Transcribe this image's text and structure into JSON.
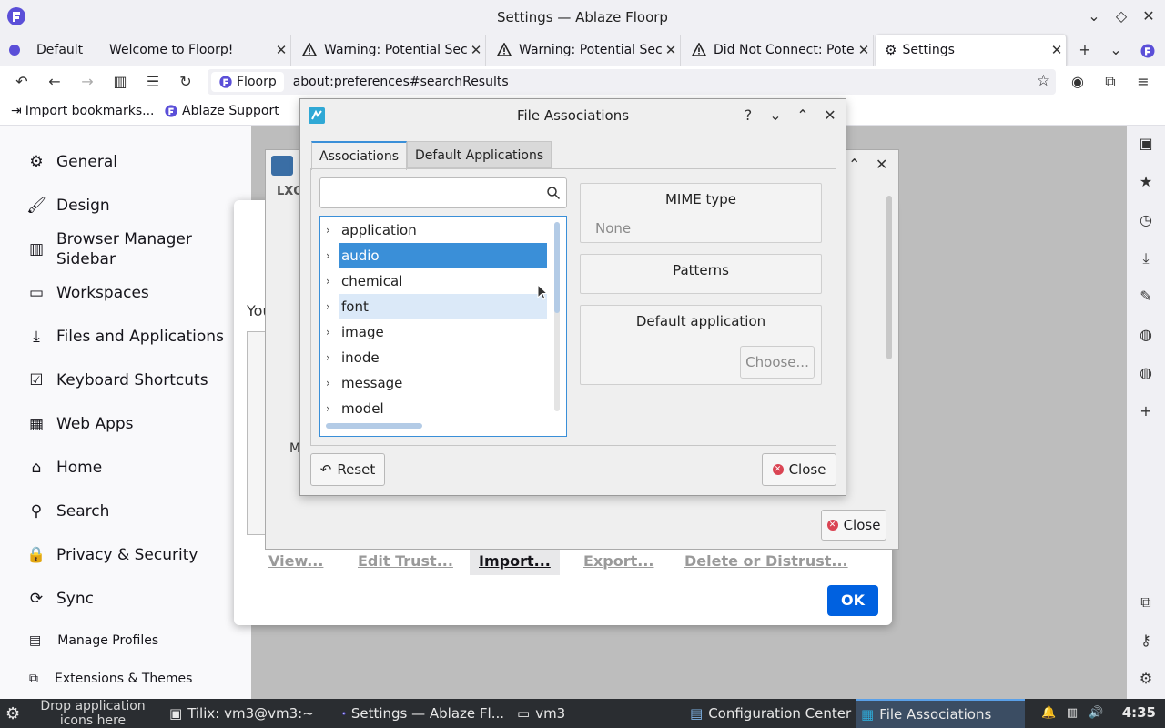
{
  "window": {
    "title": "Settings — Ablaze Floorp"
  },
  "tabs": {
    "container": "Default",
    "items": [
      {
        "label": "Welcome to Floorp!",
        "warning": false
      },
      {
        "label": "Warning: Potential Secu",
        "warning": true
      },
      {
        "label": "Warning: Potential Secu",
        "warning": true
      },
      {
        "label": "Did Not Connect: Poten",
        "warning": true
      },
      {
        "label": "Settings",
        "warning": false
      }
    ]
  },
  "navbar": {
    "identity": "Floorp",
    "url": "about:preferences#searchResults"
  },
  "bookmarks": [
    {
      "label": "Import bookmarks..."
    },
    {
      "label": "Ablaze Support"
    }
  ],
  "prefs_nav": {
    "items": [
      {
        "label": "General",
        "icon": "gear-icon"
      },
      {
        "label": "Design",
        "icon": "brush-icon"
      },
      {
        "label": "Browser Manager\nSidebar",
        "icon": "sidebar-icon"
      },
      {
        "label": "Workspaces",
        "icon": "workspaces-icon"
      },
      {
        "label": "Files and Applications",
        "icon": "download-icon"
      },
      {
        "label": "Keyboard Shortcuts",
        "icon": "checkbox-icon"
      },
      {
        "label": "Web Apps",
        "icon": "webapps-icon"
      },
      {
        "label": "Home",
        "icon": "home-icon"
      },
      {
        "label": "Search",
        "icon": "search-icon"
      },
      {
        "label": "Privacy & Security",
        "icon": "lock-icon"
      },
      {
        "label": "Sync",
        "icon": "sync-icon"
      }
    ],
    "small": [
      {
        "label": "Manage Profiles"
      },
      {
        "label": "Extensions & Themes"
      }
    ]
  },
  "cert_dialog": {
    "you_text": "You",
    "buttons": [
      "View...",
      "Edit Trust...",
      "Import...",
      "Export...",
      "Delete or Distrust..."
    ],
    "ok": "OK"
  },
  "config_center": {
    "label": "LXQ",
    "close": "Close",
    "side_letter": "M"
  },
  "file_assoc": {
    "title": "File Associations",
    "tabs": [
      "Associations",
      "Default Applications"
    ],
    "search_placeholder": "",
    "tree": [
      "application",
      "audio",
      "chemical",
      "font",
      "image",
      "inode",
      "message",
      "model"
    ],
    "selected": "audio",
    "hovered": "font",
    "mime_group": {
      "title": "MIME type",
      "value": "None"
    },
    "patterns_group": {
      "title": "Patterns"
    },
    "default_app_group": {
      "title": "Default application",
      "choose": "Choose..."
    },
    "reset": "Reset",
    "close": "Close"
  },
  "taskbar": {
    "drop_hint": "Drop application icons here",
    "items": [
      {
        "label": "Tilix: vm3@vm3:~"
      },
      {
        "label": "Settings — Ablaze Fl..."
      },
      {
        "label": "vm3"
      },
      {
        "label": "Configuration Center"
      },
      {
        "label": "File Associations"
      }
    ],
    "clock": "4:35"
  },
  "colors": {
    "accent": "#3a8fd8",
    "ok_button": "#0061e0",
    "brand": "#5b4fd8"
  }
}
